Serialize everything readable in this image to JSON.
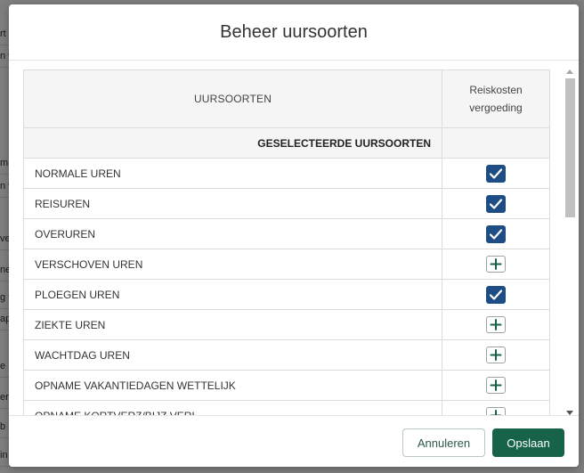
{
  "background": {
    "row_snippets": [
      "rt",
      "n v",
      "m",
      "n v",
      "ve",
      "ne",
      "g f",
      "ap",
      "e",
      "er",
      "b",
      "in"
    ]
  },
  "modal": {
    "title": "Beheer uursoorten",
    "table": {
      "col_uursoorten": "UURSOORTEN",
      "col_reiskosten_line1": "Reiskosten",
      "col_reiskosten_line2": "vergoeding",
      "section_label": "GESELECTEERDE UURSOORTEN",
      "rows": [
        {
          "name": "NORMALE UREN",
          "checked": true
        },
        {
          "name": "REISUREN",
          "checked": true
        },
        {
          "name": "OVERUREN",
          "checked": true
        },
        {
          "name": "VERSCHOVEN UREN",
          "checked": false
        },
        {
          "name": "PLOEGEN UREN",
          "checked": true
        },
        {
          "name": "ZIEKTE UREN",
          "checked": false
        },
        {
          "name": "WACHTDAG UREN",
          "checked": false
        },
        {
          "name": "OPNAME VAKANTIEDAGEN WETTELIJK",
          "checked": false
        },
        {
          "name": "OPNAME KORTVERZ/BIJZ.VERL",
          "checked": false
        }
      ]
    },
    "footer": {
      "cancel_label": "Annuleren",
      "save_label": "Opslaan"
    }
  },
  "colors": {
    "checked_bg": "#1d4d84",
    "unchecked_icon": "#17634a",
    "primary_button": "#17634a"
  },
  "icons": {
    "checked": "check-icon",
    "unchecked": "plus-icon"
  }
}
